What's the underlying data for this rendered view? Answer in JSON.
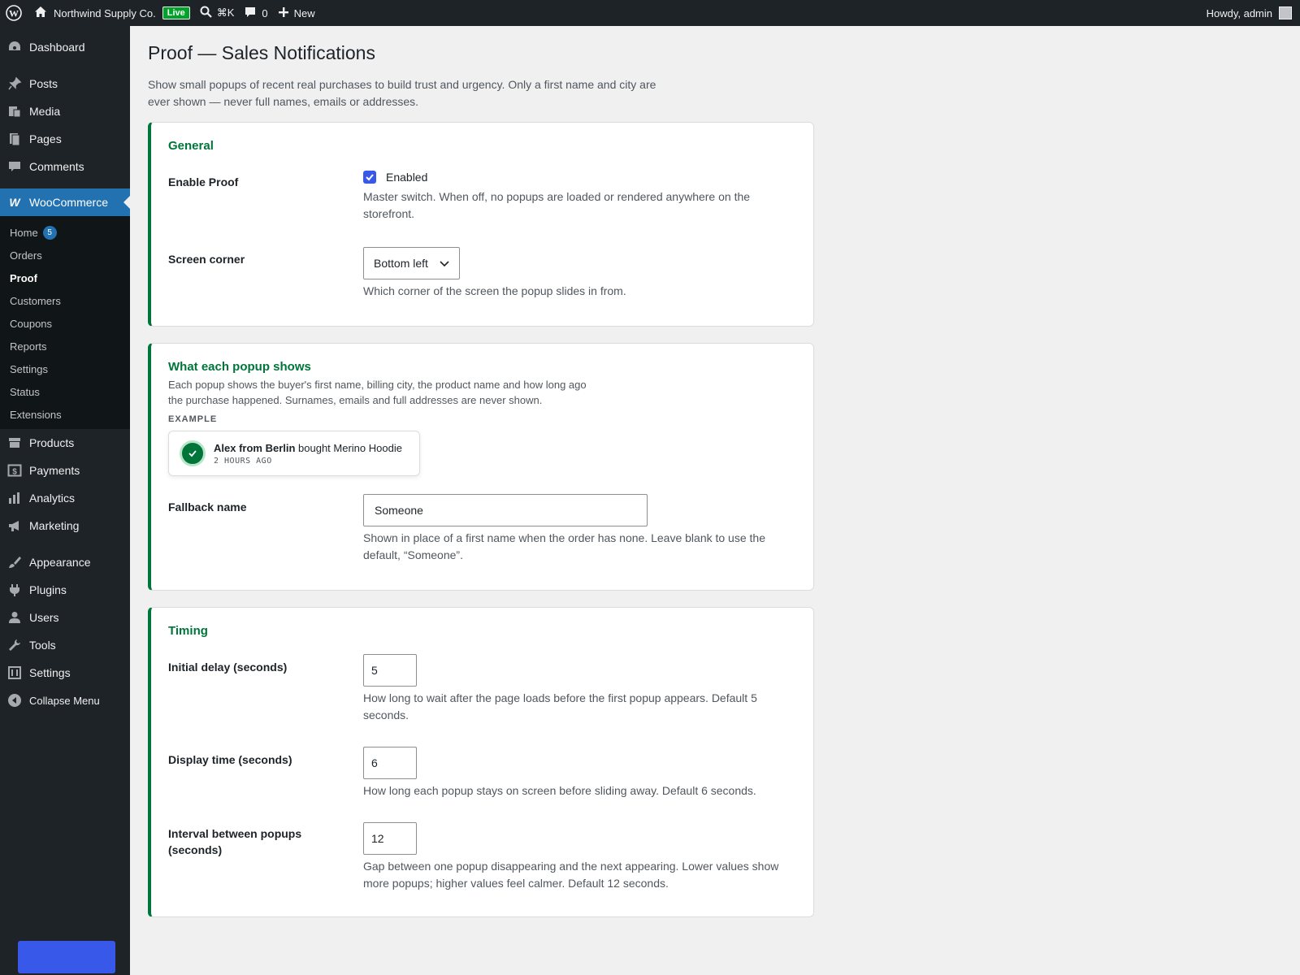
{
  "adminbar": {
    "site_name": "Northwind Supply Co.",
    "live_badge": "Live",
    "search_shortcut": "⌘K",
    "comment_count": "0",
    "new_label": "New",
    "howdy": "Howdy, admin"
  },
  "sidebar": {
    "dashboard": "Dashboard",
    "posts": "Posts",
    "media": "Media",
    "pages": "Pages",
    "comments": "Comments",
    "woocommerce": "WooCommerce",
    "sub": {
      "home": "Home",
      "home_badge": "5",
      "orders": "Orders",
      "proof": "Proof",
      "customers": "Customers",
      "coupons": "Coupons",
      "reports": "Reports",
      "settings": "Settings",
      "status": "Status",
      "extensions": "Extensions"
    },
    "products": "Products",
    "payments": "Payments",
    "analytics": "Analytics",
    "marketing": "Marketing",
    "appearance": "Appearance",
    "plugins": "Plugins",
    "users": "Users",
    "tools": "Tools",
    "settings": "Settings",
    "collapse": "Collapse Menu"
  },
  "page": {
    "title": "Proof — Sales Notifications",
    "description": "Show small popups of recent real purchases to build trust and urgency. Only a first name and city are ever shown — never full names, emails or addresses."
  },
  "general": {
    "heading": "General",
    "enable_label": "Enable Proof",
    "enable_checkbox_label": "Enabled",
    "enable_checked": true,
    "enable_help": "Master switch. When off, no popups are loaded or rendered anywhere on the storefront.",
    "corner_label": "Screen corner",
    "corner_value": "Bottom left",
    "corner_help": "Which corner of the screen the popup slides in from."
  },
  "popup": {
    "heading": "What each popup shows",
    "description": "Each popup shows the buyer's first name, billing city, the product name and how long ago the purchase happened. Surnames, emails and full addresses are never shown.",
    "example_label": "EXAMPLE",
    "example_name_city": "Alex from Berlin",
    "example_action": " bought Merino Hoodie",
    "example_time": "2 HOURS AGO",
    "fallback_label": "Fallback name",
    "fallback_value": "Someone",
    "fallback_help": "Shown in place of a first name when the order has none. Leave blank to use the default, “Someone”."
  },
  "timing": {
    "heading": "Timing",
    "initial_delay_label": "Initial delay (seconds)",
    "initial_delay_value": "5",
    "initial_delay_help": "How long to wait after the page loads before the first popup appears. Default 5 seconds.",
    "display_time_label": "Display time (seconds)",
    "display_time_value": "6",
    "display_time_help": "How long each popup stays on screen before sliding away. Default 6 seconds.",
    "interval_label": "Interval between popups (seconds)",
    "interval_value": "12",
    "interval_help": "Gap between one popup disappearing and the next appearing. Lower values show more popups; higher values feel calmer. Default 12 seconds."
  },
  "colors": {
    "accent": "#3858e9",
    "section_green": "#00753a",
    "admin_dark": "#1d2327"
  },
  "icons": {
    "wp_logo": "wordpress-icon",
    "home": "home-icon",
    "search": "search-icon",
    "comments": "comment-icon",
    "new": "plus-icon",
    "check": "check-icon"
  }
}
